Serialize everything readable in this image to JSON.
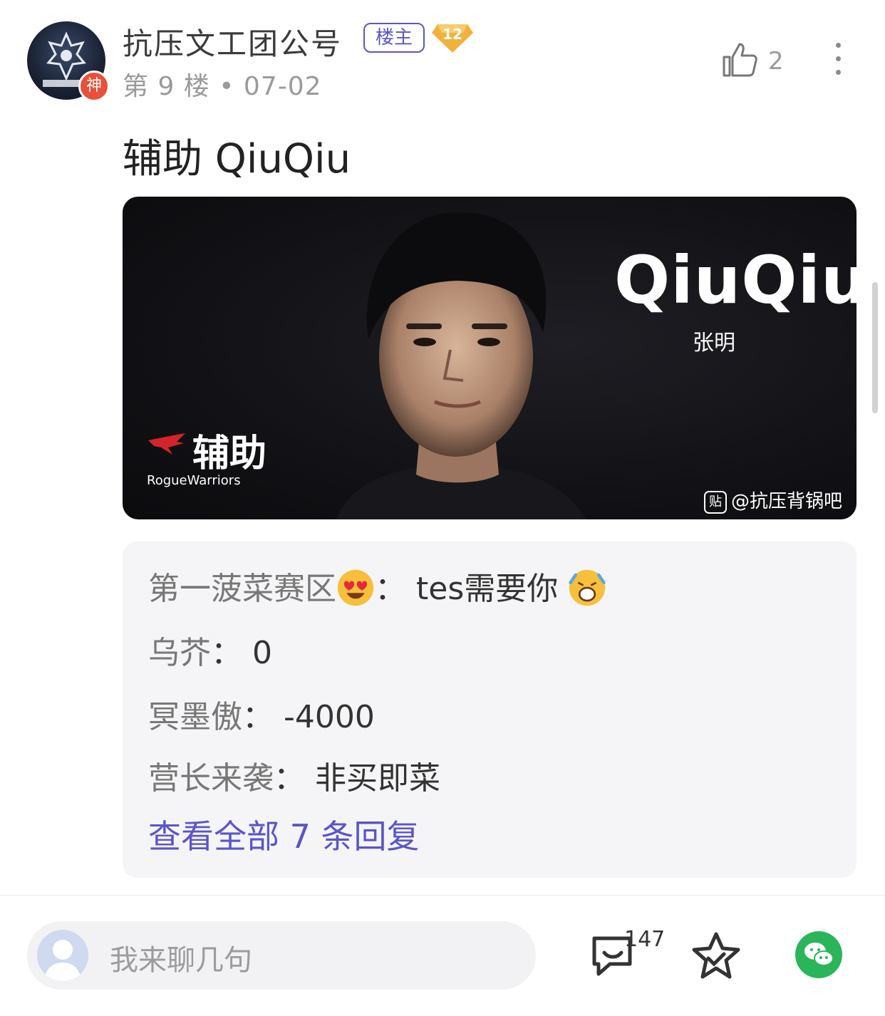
{
  "post": {
    "author": "抗压文工团公号",
    "owner_tag": "楼主",
    "level": "12",
    "avatar_badge": "神",
    "floor_and_date": "第 9 楼 • 07-02",
    "like_count": "2",
    "text": "辅助 QiuQiu"
  },
  "image": {
    "player_name": "QiuQiu",
    "real_name": "张明",
    "role": "辅助",
    "team": "RogueWarriors",
    "watermark_icon": "贴",
    "watermark": "@抗压背锅吧"
  },
  "replies": {
    "items": [
      {
        "author": "第一菠菜赛区",
        "content": "tes需要你"
      },
      {
        "author": "乌芥",
        "content": "0"
      },
      {
        "author": "冥墨傲",
        "content": "-4000"
      },
      {
        "author": "营长来袭",
        "content": "非买即菜"
      }
    ],
    "view_all": "查看全部 7 条回复"
  },
  "bottom_bar": {
    "input_placeholder": "我来聊几句",
    "comment_count": "147"
  },
  "colors": {
    "accent": "#5b55c9",
    "wechat": "#2bb55b",
    "level_badge": "#f0b23a",
    "god_badge": "#e8503a"
  },
  "icons": [
    "like-icon",
    "more-icon",
    "comment-icon",
    "star-icon",
    "wechat-icon"
  ]
}
